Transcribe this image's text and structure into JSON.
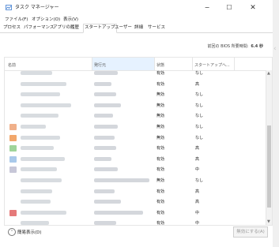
{
  "window": {
    "title": "タスク マネージャー",
    "minimize": "−",
    "maximize": "☐",
    "close": "✕"
  },
  "menu": [
    "ファイル(F)",
    "オプション(O)",
    "表示(V)"
  ],
  "tabs": [
    {
      "label": "プロセス",
      "active": false
    },
    {
      "label": "パフォーマンス",
      "active": false
    },
    {
      "label": "アプリの履歴",
      "active": false
    },
    {
      "label": "スタートアップ",
      "active": true
    },
    {
      "label": "ユーザー",
      "active": false
    },
    {
      "label": "詳細",
      "active": false
    },
    {
      "label": "サービス",
      "active": false
    }
  ],
  "bios": {
    "label": "前回の BIOS 所要時間:",
    "value": "6.4 秒"
  },
  "columns": {
    "name": "名前",
    "publisher": "発行元",
    "status": "状態",
    "impact": "スタートアップへ..."
  },
  "rows": [
    {
      "status": "有効",
      "impact": "なし",
      "icon": ""
    },
    {
      "status": "有効",
      "impact": "高",
      "icon": ""
    },
    {
      "status": "無効",
      "impact": "なし",
      "icon": ""
    },
    {
      "status": "無効",
      "impact": "なし",
      "icon": ""
    },
    {
      "status": "無効",
      "impact": "なし",
      "icon": ""
    },
    {
      "status": "無効",
      "impact": "なし",
      "icon": "#f0b08a"
    },
    {
      "status": "無効",
      "impact": "なし",
      "icon": "#f2a76b"
    },
    {
      "status": "有効",
      "impact": "高",
      "icon": "#9fd49a"
    },
    {
      "status": "有効",
      "impact": "高",
      "icon": "#a9c9ea"
    },
    {
      "status": "有効",
      "impact": "中",
      "icon": "#c7c7d8"
    },
    {
      "status": "無効",
      "impact": "なし",
      "icon": ""
    },
    {
      "status": "有効",
      "impact": "高",
      "icon": ""
    },
    {
      "status": "有効",
      "impact": "高",
      "icon": ""
    },
    {
      "status": "有効",
      "impact": "中",
      "icon": "#e57a7a"
    },
    {
      "status": "有効",
      "impact": "中",
      "icon": ""
    }
  ],
  "footer": {
    "fewer_details": "簡易表示(D)",
    "disable_button": "無効にする(A)"
  }
}
